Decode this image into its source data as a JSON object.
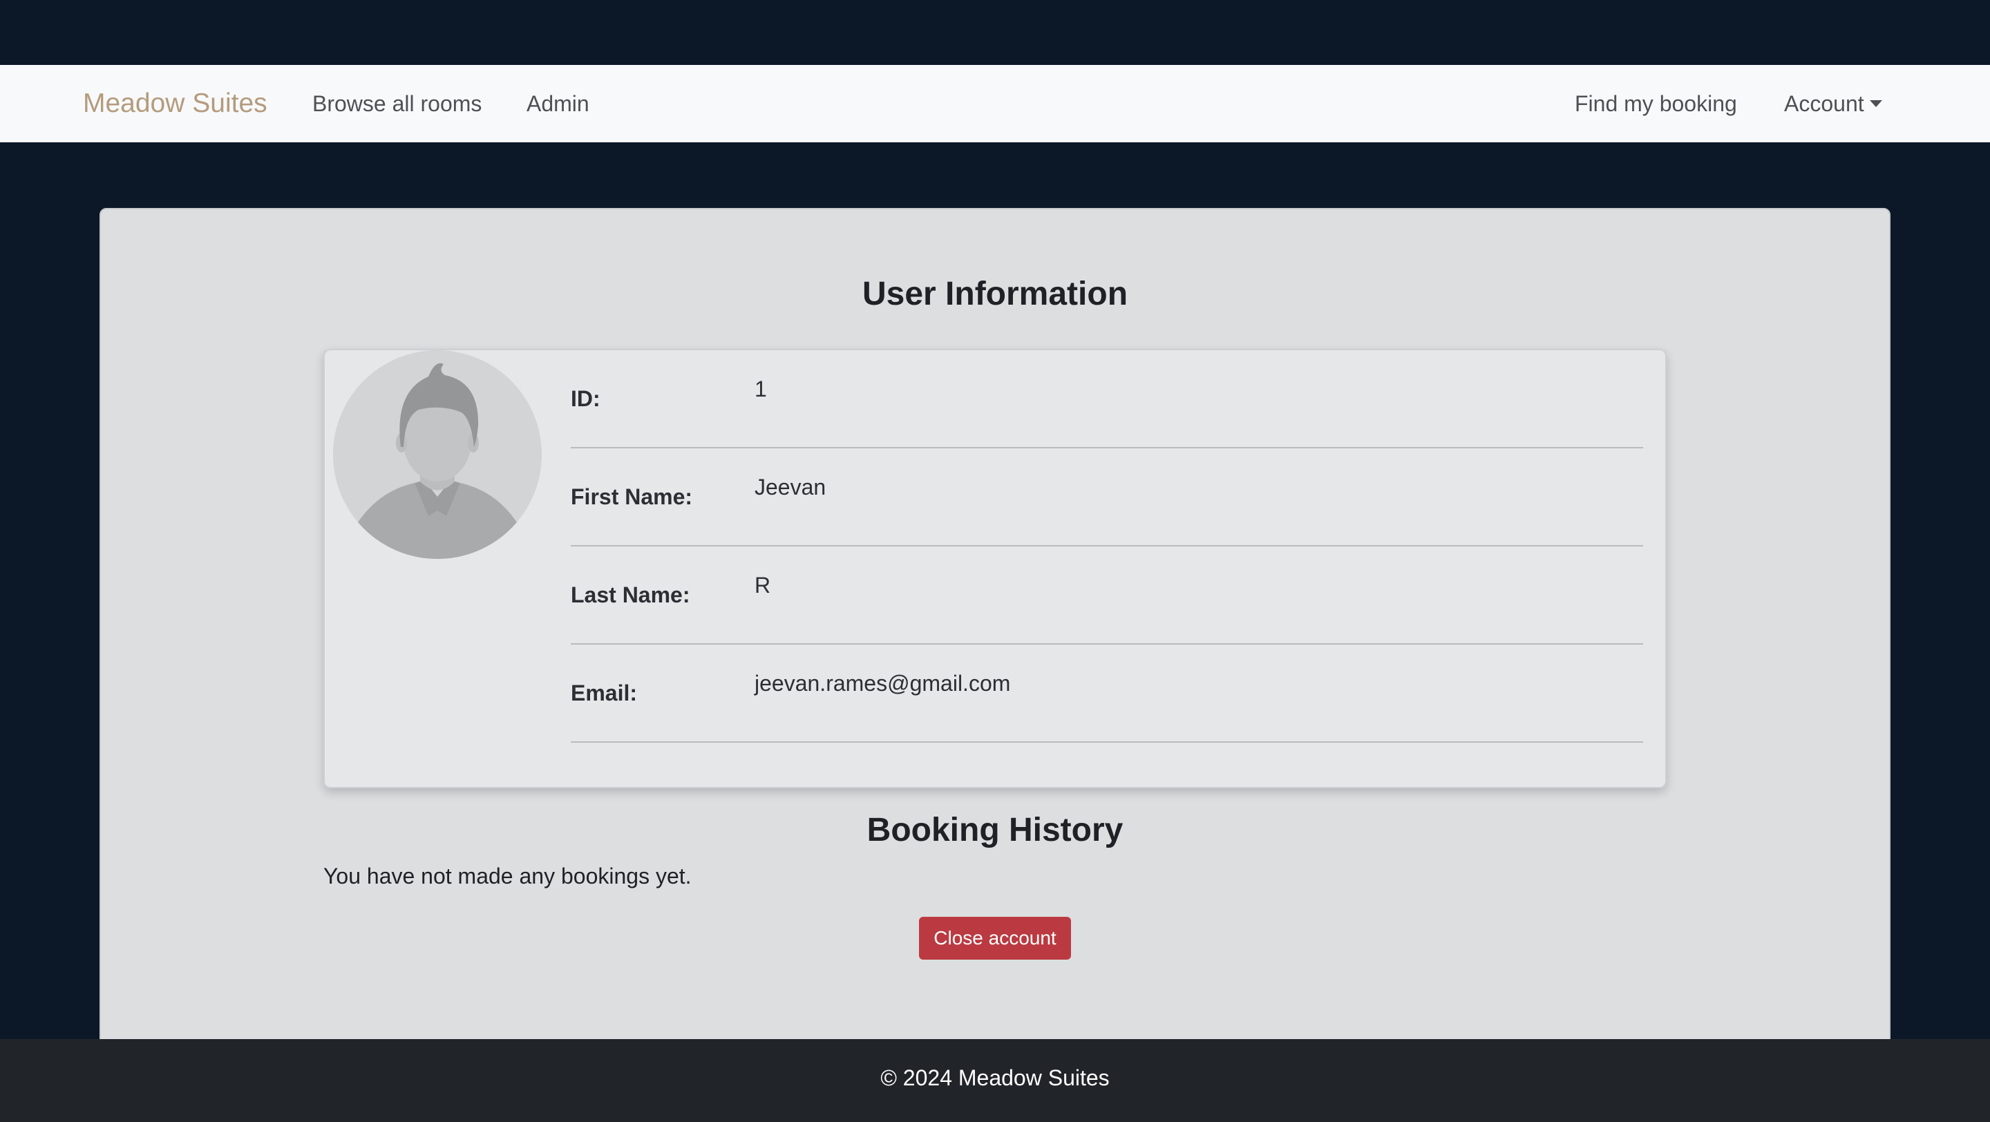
{
  "navbar": {
    "brand": "Meadow Suites",
    "links": {
      "browse": "Browse all rooms",
      "admin": "Admin",
      "find_booking": "Find my booking",
      "account": "Account"
    },
    "account_icon": "caret-down-icon"
  },
  "user_info": {
    "title": "User Information",
    "avatar_icon": "user-avatar-icon",
    "fields": {
      "id": {
        "label": "ID:",
        "value": "1"
      },
      "first_name": {
        "label": "First Name:",
        "value": "Jeevan"
      },
      "last_name": {
        "label": "Last Name:",
        "value": "R"
      },
      "email": {
        "label": "Email:",
        "value": "jeevan.rames@gmail.com"
      }
    }
  },
  "booking_history": {
    "title": "Booking History",
    "empty_message": "You have not made any bookings yet."
  },
  "actions": {
    "close_account": "Close account"
  },
  "footer": {
    "text": "© 2024 Meadow Suites"
  },
  "colors": {
    "page_background": "#0c1827",
    "navbar_background": "#f8f9fa",
    "brand": "#b49b7d",
    "panel_background": "#dddee0",
    "danger": "#bb3a41",
    "footer_background": "#212529"
  }
}
